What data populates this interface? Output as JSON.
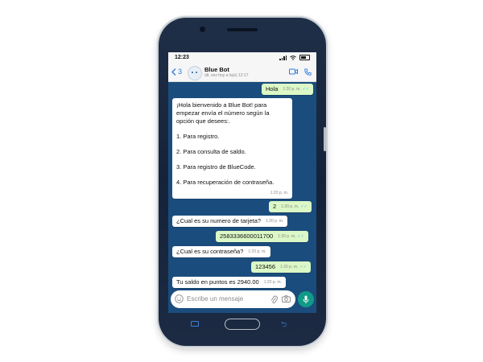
{
  "status_bar": {
    "time": "12:23"
  },
  "header": {
    "back_count": "3",
    "contact_name": "Blue Bot",
    "contact_status": "últ. vez hoy a la(s) 12:17"
  },
  "messages": [
    {
      "direction": "out",
      "text": "Hola",
      "time": "1:20 p. m."
    },
    {
      "direction": "in",
      "lines": [
        "¡Hola bienvenido a Blue Bot! para empezar envía el número según la opción que desees:.",
        "1. Para registro.",
        "2. Para consulta de saldo.",
        "3. Para registro de BlueCode.",
        "4. Para recuperación de contraseña."
      ],
      "time": "1:20 p. m."
    },
    {
      "direction": "out",
      "text": "2",
      "time": "1:20 p. m."
    },
    {
      "direction": "in",
      "text": "¿Cual es su numero de tarjeta?",
      "time": "1:20 p. m."
    },
    {
      "direction": "out",
      "text": "2583336600011700",
      "time": "1:20 p. m."
    },
    {
      "direction": "in",
      "text": "¿Cual es su contraseña?",
      "time": "1:20 p. m."
    },
    {
      "direction": "out",
      "text": "123456",
      "time": "1:20 p. m."
    },
    {
      "direction": "in",
      "text": "Tu saldo en puntos es 2940.00",
      "time": "1:20 p. m."
    }
  ],
  "input": {
    "placeholder": "Escribe un mensaje"
  },
  "icons": {
    "back": "chevron-left-icon",
    "video": "video-call-icon",
    "phone": "phone-call-icon",
    "emoji": "emoji-icon",
    "attach": "paperclip-icon",
    "camera": "camera-icon",
    "mic": "microphone-icon"
  },
  "colors": {
    "chat_background": "#1a4d7d",
    "outgoing_bubble": "#dcf8c6",
    "incoming_bubble": "#ffffff",
    "accent_blue": "#2a7be4",
    "mic_button": "#119a87",
    "read_ticks": "#4fb6ec"
  }
}
